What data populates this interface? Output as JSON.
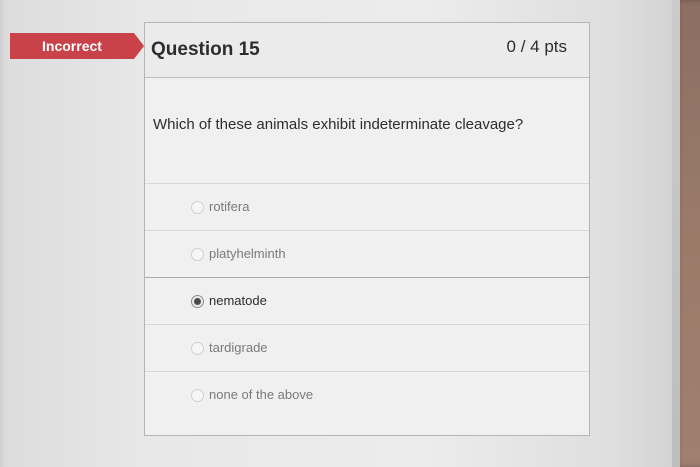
{
  "status_badge": "Incorrect",
  "question": {
    "title": "Question 15",
    "points": "0 / 4 pts",
    "text": "Which of these animals exhibit indeterminate cleavage?"
  },
  "answers": [
    {
      "label": "rotifera",
      "selected": false
    },
    {
      "label": "platyhelminth",
      "selected": false
    },
    {
      "label": "nematode",
      "selected": true
    },
    {
      "label": "tardigrade",
      "selected": false
    },
    {
      "label": "none of the above",
      "selected": false
    }
  ],
  "colors": {
    "badge": "#c9424a",
    "background": "#ececec",
    "text": "#2d2d2d",
    "muted_text": "#7a7a7a"
  }
}
